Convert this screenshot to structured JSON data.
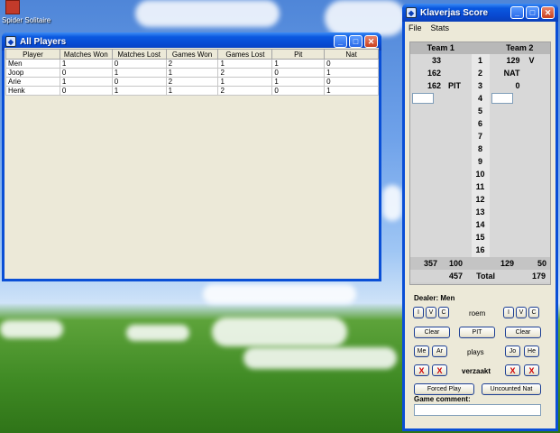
{
  "desktop": {
    "icon_label": "Spider Solitaire"
  },
  "players_window": {
    "title": "All Players",
    "columns": [
      "Player",
      "Matches Won",
      "Matches Lost",
      "Games Won",
      "Games Lost",
      "Pit",
      "Nat"
    ],
    "rows": [
      [
        "Men",
        "1",
        "0",
        "2",
        "1",
        "1",
        "0"
      ],
      [
        "Joop",
        "0",
        "1",
        "1",
        "2",
        "0",
        "1"
      ],
      [
        "Arie",
        "1",
        "0",
        "2",
        "1",
        "1",
        "0"
      ],
      [
        "Henk",
        "0",
        "1",
        "1",
        "2",
        "0",
        "1"
      ]
    ]
  },
  "score_window": {
    "title": "Klaverjas Score",
    "menu": [
      "File",
      "Stats"
    ],
    "team1_label": "Team 1",
    "team2_label": "Team 2",
    "rounds": [
      "1",
      "2",
      "3",
      "4",
      "5",
      "6",
      "7",
      "8",
      "9",
      "10",
      "11",
      "12",
      "13",
      "14",
      "15",
      "16"
    ],
    "team1_scores": [
      {
        "value": "33",
        "tag": ""
      },
      {
        "value": "162",
        "tag": ""
      },
      {
        "value": "162",
        "tag": "PIT"
      }
    ],
    "team2_scores": [
      {
        "value": "129",
        "tag": "V"
      },
      {
        "value": "NAT",
        "tag": ""
      },
      {
        "value": "0",
        "tag": ""
      }
    ],
    "team1_sub_a": "357",
    "team1_sub_b": "100",
    "team2_sub_a": "129",
    "team2_sub_b": "50",
    "team1_total": "457",
    "total_label": "Total",
    "team2_total": "179",
    "dealer_label": "Dealer: Men",
    "roem_label": "roem",
    "roem_buttons": [
      "I",
      "V",
      "C"
    ],
    "clear_label": "Clear",
    "pit_label": "PIT",
    "plays_label": "plays",
    "player_btns_left": [
      "Me",
      "Ar"
    ],
    "player_btns_right": [
      "Jo",
      "He"
    ],
    "verzaakt_label": "verzaakt",
    "x_label": "X",
    "forced_play_label": "Forced Play",
    "uncounted_nat_label": "Uncounted Nat",
    "game_comment_label": "Game comment:"
  }
}
